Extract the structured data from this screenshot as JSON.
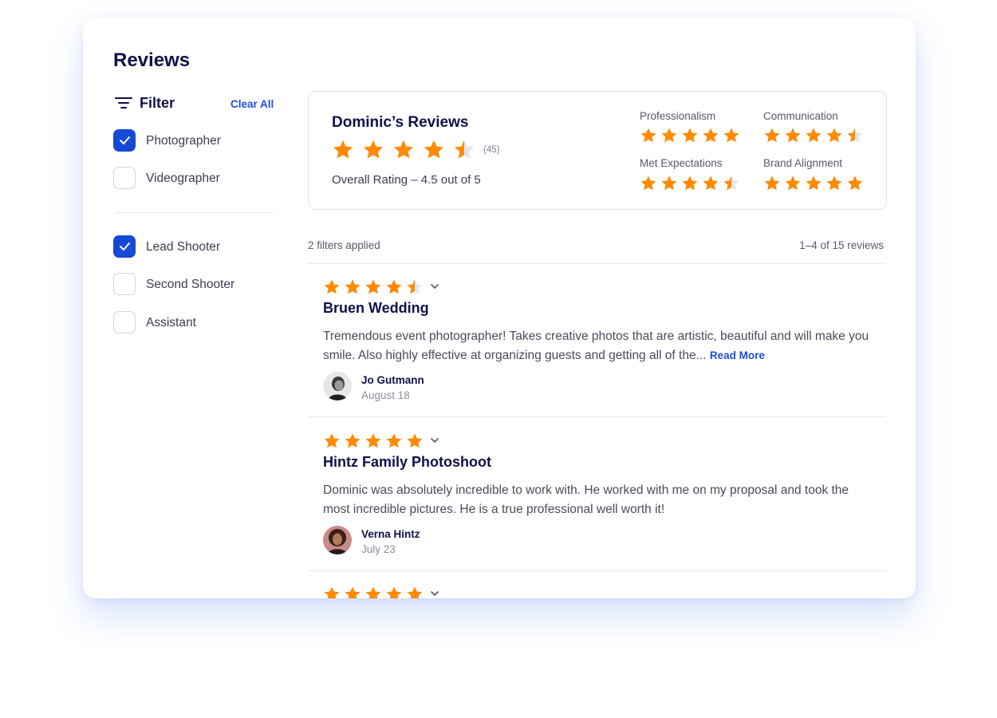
{
  "page": {
    "title": "Reviews"
  },
  "filter": {
    "title": "Filter",
    "icon": "filter-icon",
    "clear_label": "Clear All",
    "groups": [
      [
        {
          "label": "Photographer",
          "checked": true
        },
        {
          "label": "Videographer",
          "checked": false
        }
      ],
      [
        {
          "label": "Lead Shooter",
          "checked": true
        },
        {
          "label": "Second Shooter",
          "checked": false
        },
        {
          "label": "Assistant",
          "checked": false
        }
      ]
    ]
  },
  "summary": {
    "title": "Dominic’s Reviews",
    "rating": 4.5,
    "count": "(45)",
    "overall": "Overall Rating – 4.5 out of 5",
    "categories": [
      {
        "label": "Professionalism",
        "rating": 5
      },
      {
        "label": "Communication",
        "rating": 4.5
      },
      {
        "label": "Met Expectations",
        "rating": 4.5
      },
      {
        "label": "Brand Alignment",
        "rating": 5
      }
    ]
  },
  "list_meta": {
    "filters_applied": "2 filters applied",
    "range": "1–4 of 15 reviews"
  },
  "reviews": [
    {
      "rating": 4.5,
      "title": "Bruen Wedding",
      "body": "Tremendous event photographer! Takes creative photos that are artistic, beautiful and will make you smile. Also highly effective at organizing guests and getting all of the...",
      "read_more": "Read More",
      "author": "Jo Gutmann",
      "date": "August 18"
    },
    {
      "rating": 5,
      "title": "Hintz Family Photoshoot",
      "body": "Dominic was absolutely incredible to work with. He worked with me on my proposal and took the most incredible pictures. He is a true professional well worth it!",
      "author": "Verna Hintz",
      "date": "July 23"
    },
    {
      "rating": 5
    }
  ],
  "colors": {
    "star": "#ff8a00",
    "star_empty": "#e4e4ee",
    "accent": "#1549d6",
    "title": "#10104a"
  }
}
